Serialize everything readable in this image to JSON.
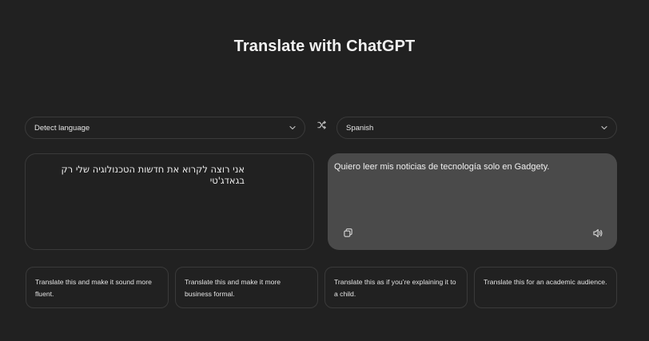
{
  "header": {
    "title": "Translate with ChatGPT"
  },
  "source_language": {
    "selected": "Detect language"
  },
  "target_language": {
    "selected": "Spanish"
  },
  "source_panel": {
    "text": "אני רוצה לקרוא את חדשות הטכנולוגיה שלי רק בגאדג'טי"
  },
  "target_panel": {
    "text": "Quiero leer mis noticias de tecnología solo en Gadgety."
  },
  "suggestions": [
    {
      "label": "Translate this and make it sound more fluent."
    },
    {
      "label": "Translate this and make it more business formal."
    },
    {
      "label": "Translate this as if you’re explaining it to a child."
    },
    {
      "label": "Translate this for an academic audience."
    }
  ],
  "icons": {
    "chevron": "chevron-down-icon",
    "swap": "swap-icon",
    "copy": "copy-icon",
    "speaker": "speaker-icon"
  },
  "colors": {
    "background": "#212121",
    "border": "#3a3a3a",
    "output_panel": "#4a4a4a",
    "text": "#ececec"
  }
}
